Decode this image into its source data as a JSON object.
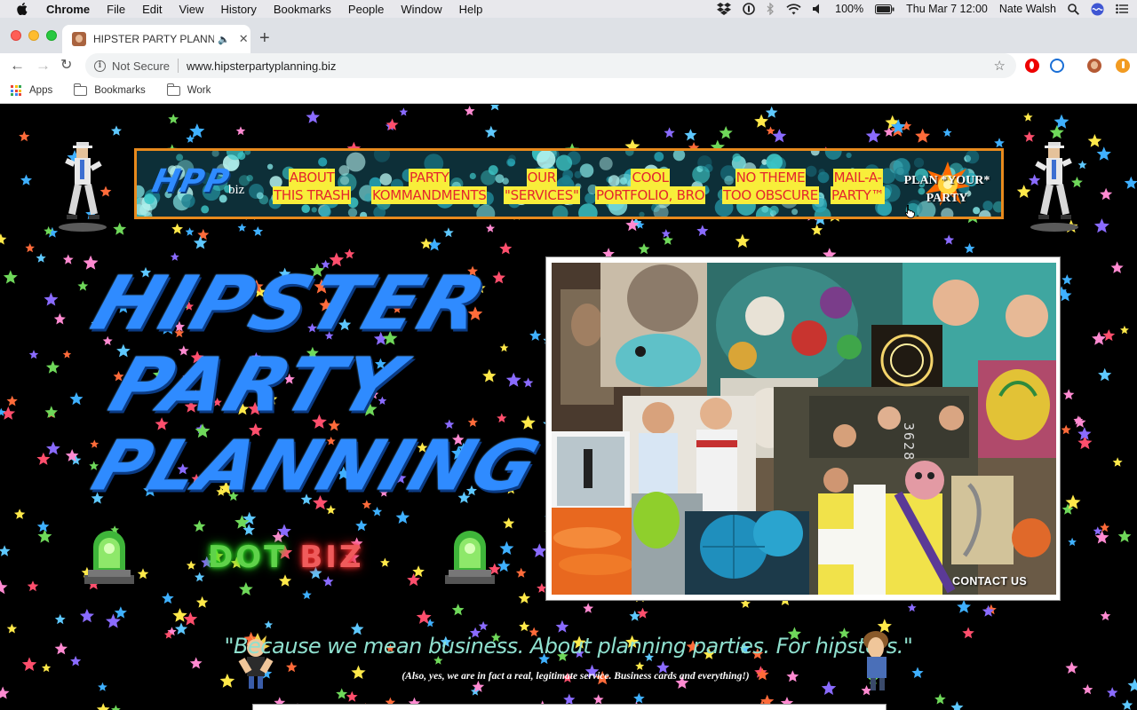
{
  "menubar": {
    "app_name": "Chrome",
    "items": [
      "File",
      "Edit",
      "View",
      "History",
      "Bookmarks",
      "People",
      "Window",
      "Help"
    ],
    "battery": "100%",
    "datetime": "Thu Mar 7  12:00",
    "user": "Nate Walsh"
  },
  "tab": {
    "title": "HIPSTER PARTY PLANNING",
    "close": "✕",
    "new_tab": "+"
  },
  "toolbar": {
    "security_label": "Not Secure",
    "url": "www.hipsterpartyplanning.biz",
    "star": "☆"
  },
  "bookmarks": {
    "items": [
      "Apps",
      "Bookmarks",
      "Work"
    ]
  },
  "page": {
    "logo_text": "HPP",
    "logo_suffix": "biz",
    "nav": [
      {
        "line1": "ABOUT",
        "line2": "THIS TRASH"
      },
      {
        "line1": "PARTY",
        "line2": "KOMMANDMENTS"
      },
      {
        "line1": "OUR",
        "line2": "\"SERVICES\""
      },
      {
        "line1": "COOL",
        "line2": "PORTFOLIO, BRO"
      },
      {
        "line1": "NO THEME",
        "line2": "TOO OBSCURE"
      },
      {
        "line1": "MAIL-A-",
        "line2": "PARTY™"
      }
    ],
    "plan_cta": {
      "line1": "PLAN *YOUR*",
      "line2": "PARTY"
    },
    "headline": [
      "HIPSTER",
      "PARTY",
      "PLANNING"
    ],
    "dot_word": "DOT",
    "biz_word": "BIZ",
    "contact_us": "CONTACT US",
    "tagline": "\"Because we mean business. About planning parties. For hipsters.\"",
    "tagline_sub": "(Also, yes, we are in fact a real, legitimate service.  Business cards and everything!)",
    "collage_text": "3628"
  },
  "colors": {
    "accent_blue": "#2f8bff",
    "nav_border": "#e88a1d",
    "nav_label_bg": "#f8ee3a",
    "nav_label_text": "#e4262d",
    "tagline": "#8fe0cf"
  }
}
